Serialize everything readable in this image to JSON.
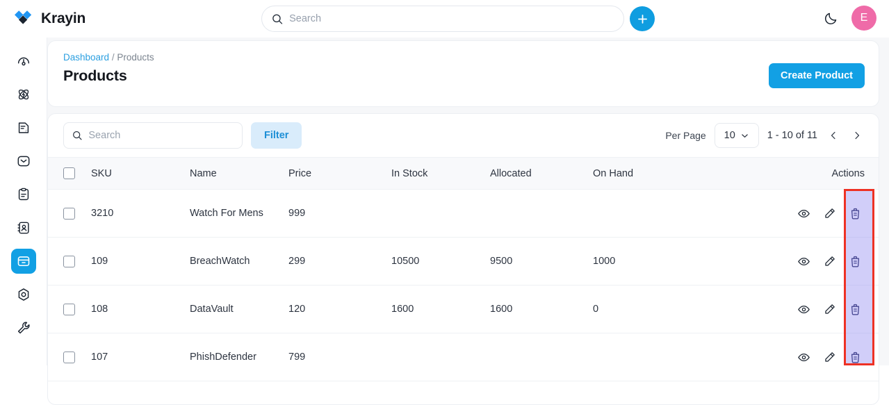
{
  "app": {
    "brand_name": "Krayin",
    "logo_icon": "krayin-diamond-logo"
  },
  "header": {
    "search_placeholder": "Search",
    "search_value": "",
    "search_icon": "search-icon",
    "create_icon": "plus-icon",
    "theme_toggle_icon": "moon-icon",
    "avatar_initial": "E"
  },
  "sidebar": {
    "items": [
      {
        "name": "dashboard",
        "icon": "gauge-icon",
        "active": false
      },
      {
        "name": "leads",
        "icon": "atom-icon",
        "active": false
      },
      {
        "name": "quotes",
        "icon": "document-icon",
        "active": false
      },
      {
        "name": "mail",
        "icon": "envelope-icon",
        "active": false
      },
      {
        "name": "activities",
        "icon": "clipboard-icon",
        "active": false
      },
      {
        "name": "contacts",
        "icon": "contact-book-icon",
        "active": false
      },
      {
        "name": "products",
        "icon": "box-icon",
        "active": true
      },
      {
        "name": "settings",
        "icon": "hexagon-gear-icon",
        "active": false
      },
      {
        "name": "configuration",
        "icon": "wrench-icon",
        "active": false
      }
    ]
  },
  "breadcrumb": {
    "root": "Dashboard",
    "separator": "/",
    "current": "Products"
  },
  "page": {
    "title": "Products",
    "create_button": "Create Product"
  },
  "toolbar": {
    "search_placeholder": "Search",
    "search_value": "",
    "search_icon": "search-icon",
    "filter_label": "Filter",
    "per_page_label": "Per Page",
    "per_page_value": "10",
    "per_page_chevron": "chevron-down-icon",
    "range_text": "1 - 10 of 11",
    "prev_icon": "chevron-left-icon",
    "next_icon": "chevron-right-icon"
  },
  "table": {
    "columns": [
      {
        "key": "checkbox",
        "label": ""
      },
      {
        "key": "sku",
        "label": "SKU"
      },
      {
        "key": "name",
        "label": "Name"
      },
      {
        "key": "price",
        "label": "Price"
      },
      {
        "key": "in_stock",
        "label": "In Stock"
      },
      {
        "key": "allocated",
        "label": "Allocated"
      },
      {
        "key": "on_hand",
        "label": "On Hand"
      },
      {
        "key": "actions",
        "label": "Actions"
      }
    ],
    "row_action_icons": [
      "eye-icon",
      "pencil-icon",
      "trash-icon"
    ],
    "rows": [
      {
        "sku": "3210",
        "name": "Watch For Mens",
        "price": "999",
        "in_stock": "",
        "allocated": "",
        "on_hand": ""
      },
      {
        "sku": "109",
        "name": "BreachWatch",
        "price": "299",
        "in_stock": "10500",
        "allocated": "9500",
        "on_hand": "1000"
      },
      {
        "sku": "108",
        "name": "DataVault",
        "price": "120",
        "in_stock": "1600",
        "allocated": "1600",
        "on_hand": "0"
      },
      {
        "sku": "107",
        "name": "PhishDefender",
        "price": "799",
        "in_stock": "",
        "allocated": "",
        "on_hand": ""
      }
    ]
  },
  "annotation": {
    "highlight_color": "#ee3124",
    "highlight_fill": "#918af1",
    "target": "delete-action-column"
  },
  "colors": {
    "accent": "#12a0e4",
    "link": "#2b9fe0",
    "filter_bg": "#d9ecfb",
    "avatar_bg": "#ef6ba8",
    "page_bg": "#f6f7f9"
  }
}
